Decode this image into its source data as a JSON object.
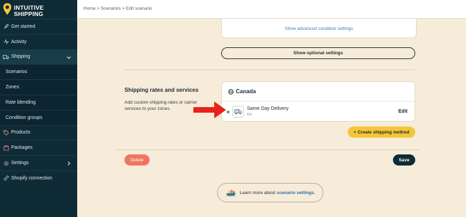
{
  "brand": {
    "line1": "INTUITIVE",
    "line2": "SHIPPING"
  },
  "sidebar": {
    "items": [
      {
        "label": "Get started",
        "icon": "rocket-icon"
      },
      {
        "label": "Activity",
        "icon": "activity-icon"
      },
      {
        "label": "Shipping",
        "icon": "truck-icon",
        "expanded": true
      },
      {
        "label": "Scenarios"
      },
      {
        "label": "Zones"
      },
      {
        "label": "Rate blending"
      },
      {
        "label": "Condition groups"
      },
      {
        "label": "Products",
        "icon": "tag-icon"
      },
      {
        "label": "Packages",
        "icon": "package-icon"
      },
      {
        "label": "Settings",
        "icon": "gear-icon"
      },
      {
        "label": "Shopify connection",
        "icon": "link-icon"
      }
    ]
  },
  "breadcrumb": "Home > Scenarios > Edit scenario",
  "conditions": {
    "advanced_link": "Show advanced condition settings"
  },
  "optional_button": "Show optional settings",
  "rates": {
    "title": "Shipping rates and services",
    "description": "Add custom shipping rates or carrier services to your zones.",
    "zone": {
      "name": "Canada",
      "method": {
        "name": "Same Day Delivery",
        "status": "On",
        "edit_label": "Edit"
      }
    },
    "create_button": "Create shipping method",
    "create_icon": "+"
  },
  "actions": {
    "delete_label": "Delete",
    "save_label": "Save"
  },
  "learn": {
    "prefix": "Learn more about",
    "link": "scenario settings",
    "suffix": "."
  },
  "colors": {
    "sidebar_bg": "#0f2b36",
    "page_bg": "#f6ecd9",
    "accent_yellow": "#f5c638",
    "delete_red": "#ee7562",
    "link_blue": "#3c7fb3",
    "status_green": "#4caf50",
    "arrow_red": "#e8231a"
  }
}
